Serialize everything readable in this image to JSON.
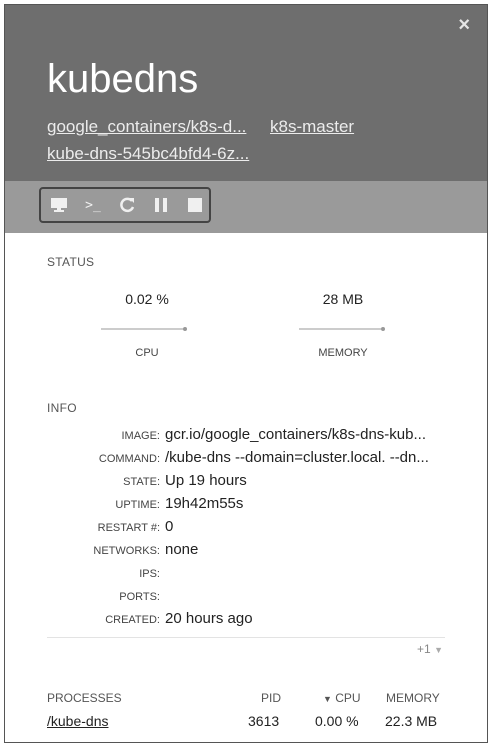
{
  "header": {
    "title": "kubedns",
    "image_link": "google_containers/k8s-d...",
    "node_link": "k8s-master",
    "pod_link": "kube-dns-545bc4bfd4-6z...",
    "close_label": "×"
  },
  "toolbar": {
    "buttons": [
      {
        "icon": "monitor-icon"
      },
      {
        "icon": "terminal-icon"
      },
      {
        "icon": "restart-icon"
      },
      {
        "icon": "pause-icon"
      },
      {
        "icon": "stop-icon"
      }
    ],
    "terminal_glyph": ">_"
  },
  "status": {
    "label": "STATUS",
    "cpu_value": "0.02 %",
    "cpu_label": "CPU",
    "memory_value": "28 MB",
    "memory_label": "MEMORY"
  },
  "info": {
    "label": "INFO",
    "rows": [
      {
        "key": "IMAGE:",
        "value": "gcr.io/google_containers/k8s-dns-kub..."
      },
      {
        "key": "COMMAND:",
        "value": "/kube-dns --domain=cluster.local. --dn..."
      },
      {
        "key": "STATE:",
        "value": "Up 19 hours"
      },
      {
        "key": "UPTIME:",
        "value": "19h42m55s"
      },
      {
        "key": "RESTART #:",
        "value": "0"
      },
      {
        "key": "NETWORKS:",
        "value": "none"
      },
      {
        "key": "IPS:",
        "value": ""
      },
      {
        "key": "PORTS:",
        "value": ""
      },
      {
        "key": "CREATED:",
        "value": "20 hours ago"
      }
    ],
    "more_label": "+1"
  },
  "processes": {
    "headers": {
      "name": "PROCESSES",
      "pid": "PID",
      "cpu": "CPU",
      "memory": "MEMORY"
    },
    "rows": [
      {
        "name": "/kube-dns",
        "pid": "3613",
        "cpu": "0.00 %",
        "memory": "22.3 MB"
      }
    ]
  }
}
